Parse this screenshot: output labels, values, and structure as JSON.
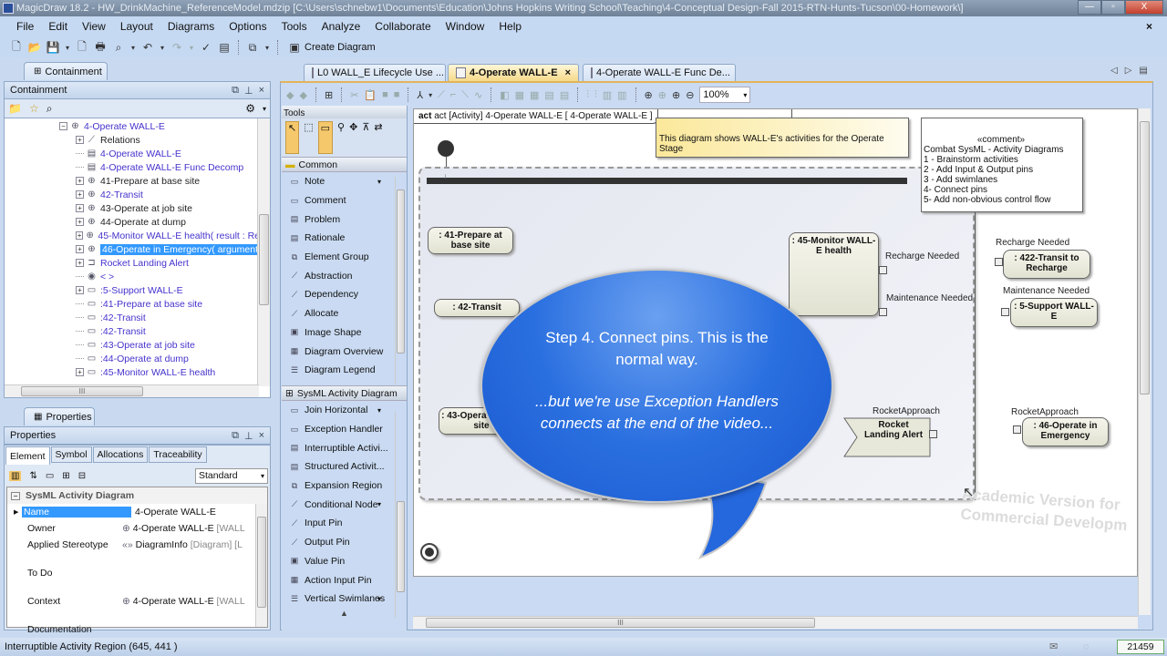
{
  "window": {
    "title": "MagicDraw 18.2 - HW_DrinkMachine_ReferenceModel.mdzip [C:\\Users\\schnebw1\\Documents\\Education\\Johns Hopkins Writing School\\Teaching\\4-Conceptual Design-Fall 2015-RTN-Hunts-Tucson\\00-Homework\\]",
    "minimize": "—",
    "restore": "▫",
    "close": "X"
  },
  "menu": [
    "File",
    "Edit",
    "View",
    "Layout",
    "Diagrams",
    "Options",
    "Tools",
    "Analyze",
    "Collaborate",
    "Window",
    "Help"
  ],
  "menu_close": "×",
  "toolbar": {
    "create_diagram": "Create Diagram"
  },
  "containment": {
    "tab_label": "Containment",
    "header": "Containment",
    "tree": [
      {
        "label": "4-Operate WALL-E",
        "indent": 0,
        "exp": "-",
        "icon": "activity",
        "color": "blue"
      },
      {
        "label": "Relations",
        "indent": 1,
        "exp": "+",
        "icon": "relation",
        "color": "black"
      },
      {
        "label": "4-Operate WALL-E",
        "indent": 1,
        "exp": "",
        "icon": "diagram",
        "color": "blue"
      },
      {
        "label": "4-Operate WALL-E Func Decomp",
        "indent": 1,
        "exp": "",
        "icon": "diagram",
        "color": "blue"
      },
      {
        "label": "41-Prepare at base site",
        "indent": 1,
        "exp": "+",
        "icon": "activity",
        "color": "black"
      },
      {
        "label": "42-Transit",
        "indent": 1,
        "exp": "+",
        "icon": "activity",
        "color": "blue"
      },
      {
        "label": "43-Operate at job site",
        "indent": 1,
        "exp": "+",
        "icon": "activity",
        "color": "black"
      },
      {
        "label": "44-Operate at dump",
        "indent": 1,
        "exp": "+",
        "icon": "activity",
        "color": "black"
      },
      {
        "label": "45-Monitor WALL-E health( result : Re",
        "indent": 1,
        "exp": "+",
        "icon": "activity",
        "color": "blue"
      },
      {
        "label": "46-Operate in Emergency( argument",
        "indent": 1,
        "exp": "+",
        "icon": "activity",
        "color": "sel"
      },
      {
        "label": "Rocket Landing Alert",
        "indent": 1,
        "exp": "+",
        "icon": "signal",
        "color": "blue"
      },
      {
        "label": "< >",
        "indent": 1,
        "exp": "",
        "icon": "initial",
        "color": "blue"
      },
      {
        "label": ":5-Support WALL-E",
        "indent": 1,
        "exp": "+",
        "icon": "action",
        "color": "blue"
      },
      {
        "label": ":41-Prepare at base site",
        "indent": 1,
        "exp": "",
        "icon": "action",
        "color": "blue"
      },
      {
        "label": ":42-Transit",
        "indent": 1,
        "exp": "",
        "icon": "action",
        "color": "blue"
      },
      {
        "label": ":42-Transit",
        "indent": 1,
        "exp": "",
        "icon": "action",
        "color": "blue"
      },
      {
        "label": ":43-Operate at job site",
        "indent": 1,
        "exp": "",
        "icon": "action",
        "color": "blue"
      },
      {
        "label": ":44-Operate at dump",
        "indent": 1,
        "exp": "",
        "icon": "action",
        "color": "blue"
      },
      {
        "label": ":45-Monitor WALL-E health",
        "indent": 1,
        "exp": "+",
        "icon": "action",
        "color": "blue"
      }
    ]
  },
  "properties": {
    "tab_label": "Properties",
    "header": "Properties",
    "subtabs": [
      "Element",
      "Symbol",
      "Allocations",
      "Traceability"
    ],
    "filter": "Standard",
    "group": "SysML Activity Diagram",
    "rows": [
      {
        "key": "Name",
        "value": "4-Operate WALL-E",
        "extra": ""
      },
      {
        "key": "Owner",
        "value": "4-Operate WALL-E",
        "extra": " [WALL"
      },
      {
        "key": "Applied Stereotype",
        "value": "DiagramInfo",
        "extra": " [Diagram] [L"
      },
      {
        "key": "To Do",
        "value": "",
        "extra": ""
      },
      {
        "key": "Context",
        "value": "4-Operate WALL-E",
        "extra": " [WALL"
      },
      {
        "key": "Documentation",
        "value": "",
        "extra": ""
      }
    ]
  },
  "diagram_tabs": [
    {
      "label": "L0 WALL_E Lifecycle Use ...",
      "active": false
    },
    {
      "label": "4-Operate WALL-E",
      "active": true,
      "close": "×"
    },
    {
      "label": "4-Operate WALL-E Func De...",
      "active": false
    }
  ],
  "zoom_level": "100%",
  "palette": {
    "tools_label": "Tools",
    "common_label": "Common",
    "common_items": [
      "Note",
      "Comment",
      "Problem",
      "Rationale",
      "Element Group",
      "Abstraction",
      "Dependency",
      "Allocate",
      "Image Shape",
      "Diagram Overview",
      "Diagram Legend"
    ],
    "sysml_label": "SysML Activity Diagram",
    "sysml_items": [
      "Join Horizontal",
      "Exception Handler",
      "Interruptible Activi...",
      "Structured Activit...",
      "Expansion Region",
      "Conditional Node",
      "Input Pin",
      "Output Pin",
      "Value Pin",
      "Action Input Pin",
      "Vertical Swimlanes"
    ]
  },
  "diagram": {
    "frame_label": "act [Activity] 4-Operate WALL-E [ 4-Operate WALL-E ]",
    "note_text": "This diagram shows WALL-E's activities for the Operate Stage",
    "comment_stereo": "«comment»",
    "comment_lines": [
      "Combat SysML - Activity Diagrams",
      "1 - Brainstorm activities",
      "2 - Add Input & Output pins",
      "3 - Add swimlanes",
      "4- Connect pins",
      "5- Add non-obvious control flow"
    ],
    "nodes": {
      "prepare": ": 41-Prepare at base site",
      "transit": ": 42-Transit",
      "jobsite": ": 43-Operate at job site",
      "monitor": ": 45-Monitor WALL-E health",
      "transit_recharge": ": 422-Transit to Recharge",
      "support": ": 5-Support WALL-E",
      "rocket_alert": "Rocket Landing Alert",
      "emergency": ": 46-Operate in Emergency"
    },
    "pin_labels": {
      "recharge_out": "Recharge Needed",
      "maint_out": "Maintenance Needed",
      "recharge_in": "Recharge Needed",
      "maint_in": "Maintenance Needed",
      "rocket_out": "RocketApproach",
      "rocket_in": "RocketApproach"
    },
    "watermark_1": "Academic Version for",
    "watermark_2": "Commercial Developm"
  },
  "callout": {
    "line1": "Step 4. Connect pins.  This is the normal way.",
    "line2": "...but we're use Exception Handlers connects at the end of the video..."
  },
  "status": {
    "text": "Interruptible Activity Region (645, 441 )",
    "memory": "21459"
  }
}
